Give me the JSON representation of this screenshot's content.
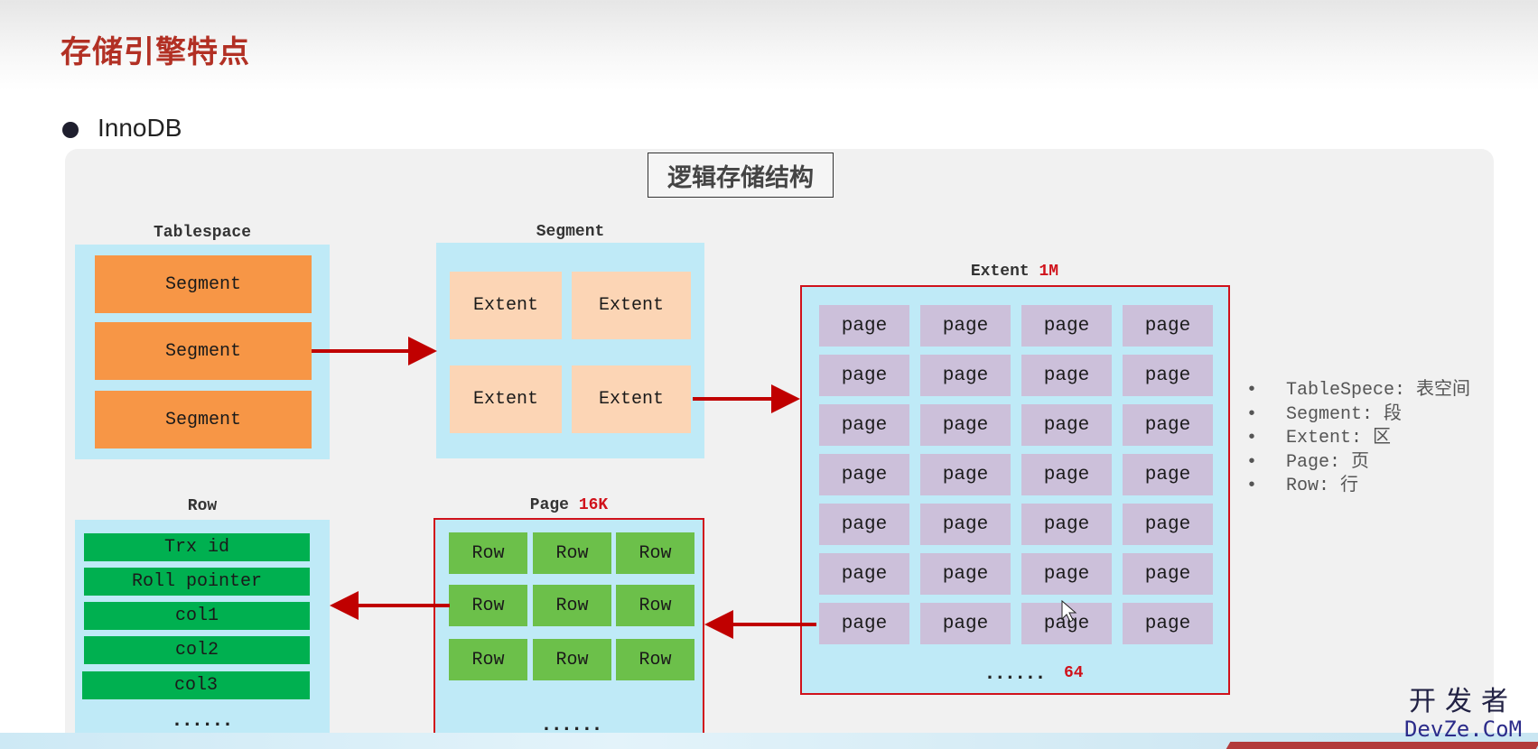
{
  "page_title": "存储引擎特点",
  "bullet": "InnoDB",
  "diagram_heading": "逻辑存储结构",
  "tablespace": {
    "label": "Tablespace",
    "items": [
      "Segment",
      "Segment",
      "Segment"
    ]
  },
  "segment": {
    "label": "Segment",
    "items": [
      "Extent",
      "Extent",
      "Extent",
      "Extent"
    ]
  },
  "extent": {
    "label": "Extent",
    "size": "1M",
    "cell": "page",
    "footer_dots": "......",
    "footer_count": "64"
  },
  "page": {
    "label": "Page",
    "size": "16K",
    "cell": "Row",
    "footer_dots": "......"
  },
  "row": {
    "label": "Row",
    "fields": [
      "Trx id",
      "Roll pointer",
      "col1",
      "col2",
      "col3"
    ],
    "footer_dots": "......"
  },
  "legend": [
    "TableSpece: 表空间",
    "Segment: 段",
    "Extent: 区",
    "Page: 页",
    "Row: 行"
  ],
  "watermark": {
    "line1": "开发者",
    "line2": "DevZe.CoM"
  },
  "colors": {
    "title_red": "#b23024",
    "panel_blue": "#bfeaf7",
    "segment_orange": "#f79646",
    "extent_peach": "#fcd5b5",
    "page_lilac": "#ccc0da",
    "row_green": "#6cc04a",
    "field_green": "#00b050",
    "arrow_red": "#c00000"
  }
}
